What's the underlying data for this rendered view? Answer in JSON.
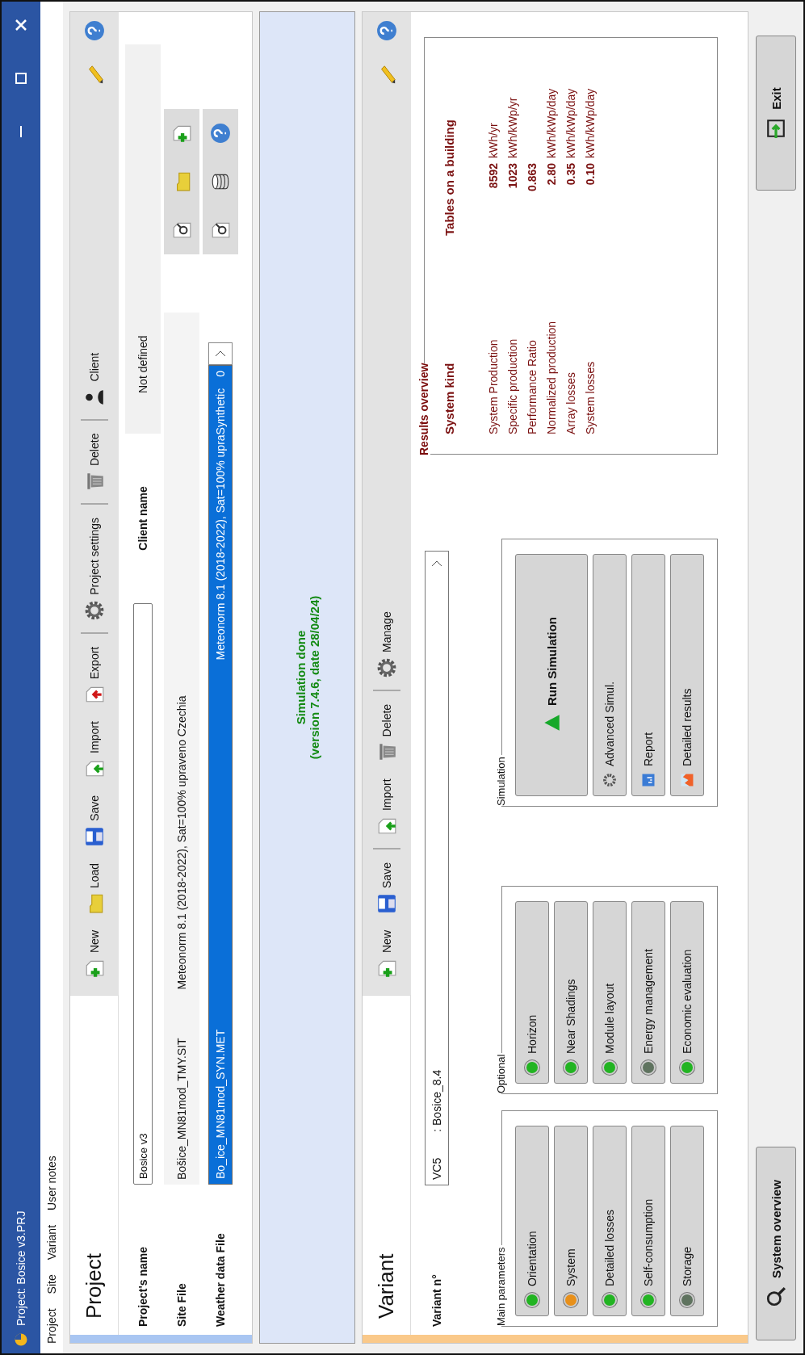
{
  "window": {
    "title": "Project:  Bosice v3.PRJ"
  },
  "menu": [
    "Project",
    "Site",
    "Variant",
    "User notes"
  ],
  "project": {
    "title": "Project",
    "toolbar": [
      {
        "label": "New",
        "kind": "new",
        "separated": false
      },
      {
        "label": "Load",
        "kind": "load",
        "separated": false
      },
      {
        "label": "Save",
        "kind": "save",
        "separated": false
      },
      {
        "label": "Import",
        "kind": "import",
        "separated": false
      },
      {
        "label": "Export",
        "kind": "export",
        "separated": false
      },
      {
        "label": "Project settings",
        "kind": "settings",
        "separated": true
      },
      {
        "label": "Delete",
        "kind": "delete",
        "separated": true
      },
      {
        "label": "Client",
        "kind": "client",
        "separated": true
      }
    ],
    "name_label": "Project's name",
    "name_value": "Bosice v3",
    "client_label": "Client name",
    "client_value": "Not defined",
    "site": {
      "label": "Site File",
      "file": "Bošice_MN81mod_TMY.SIT",
      "info": "Meteonorm 8.1 (2018-2022), Sat=100%  upraveno  Czechia"
    },
    "weather": {
      "label": "Weather data File",
      "file": "Bo_ice_MN81mod_SYN.MET",
      "info": "Meteonorm 8.1 (2018-2022), Sat=100%  upraSynthetic",
      "count": "0",
      "highlighted": true
    }
  },
  "message": [
    "Simulation done",
    "(version 7.4.6, date 28/04/24)"
  ],
  "variant": {
    "title": "Variant",
    "toolbar": [
      {
        "label": "New",
        "kind": "new",
        "separated": false
      },
      {
        "label": "Save",
        "kind": "save",
        "separated": false
      },
      {
        "label": "Import",
        "kind": "import",
        "separated": true
      },
      {
        "label": "Delete",
        "kind": "delete",
        "separated": false
      },
      {
        "label": "Manage",
        "kind": "manage",
        "separated": true
      }
    ],
    "number_label": "Variant n°",
    "number": "VC5",
    "name": ": Bosice_8.4",
    "main_parameters": {
      "title": "Main parameters",
      "items": [
        {
          "label": "Orientation",
          "color": "#22b422"
        },
        {
          "label": "System",
          "color": "#e8901a"
        },
        {
          "label": "Detailed losses",
          "color": "#22b422"
        },
        {
          "label": "Self-consumption",
          "color": "#22b422"
        },
        {
          "label": "Storage",
          "color": "#5f735f"
        }
      ]
    },
    "optional": {
      "title": "Optional",
      "items": [
        {
          "label": "Horizon",
          "color": "#22b422"
        },
        {
          "label": "Near Shadings",
          "color": "#22b422"
        },
        {
          "label": "Module layout",
          "color": "#22b422"
        },
        {
          "label": "Energy management",
          "color": "#5f735f"
        },
        {
          "label": "Economic evaluation",
          "color": "#22b422"
        }
      ]
    },
    "simulation": {
      "title": "Simulation",
      "buttons": [
        {
          "label": "Run Simulation",
          "kind": "run"
        },
        {
          "label": "Advanced Simul.",
          "kind": "advanced"
        },
        {
          "label": "Report",
          "kind": "report"
        },
        {
          "label": "Detailed results",
          "kind": "results"
        }
      ]
    },
    "results": {
      "title": "Results overview",
      "kind_label": "System kind",
      "kind_value": "Tables on a building",
      "rows": [
        {
          "label": "System Production",
          "value": "8592",
          "unit": "kWh/yr"
        },
        {
          "label": "Specific production",
          "value": "1023",
          "unit": "kWh/kWp/yr"
        },
        {
          "label": "Performance Ratio",
          "value": "0.863"
        },
        {
          "label": "Normalized production",
          "value": "2.80",
          "unit": "kWh/kWp/day"
        },
        {
          "label": "Array losses",
          "value": "0.35",
          "unit": "kWh/kWp/day"
        },
        {
          "label": "System losses",
          "value": "0.10",
          "unit": "kWh/kWp/day"
        }
      ]
    }
  },
  "footer": [
    {
      "label": "System overview",
      "kind": "overview"
    },
    {
      "label": "Exit",
      "kind": "exit"
    }
  ]
}
